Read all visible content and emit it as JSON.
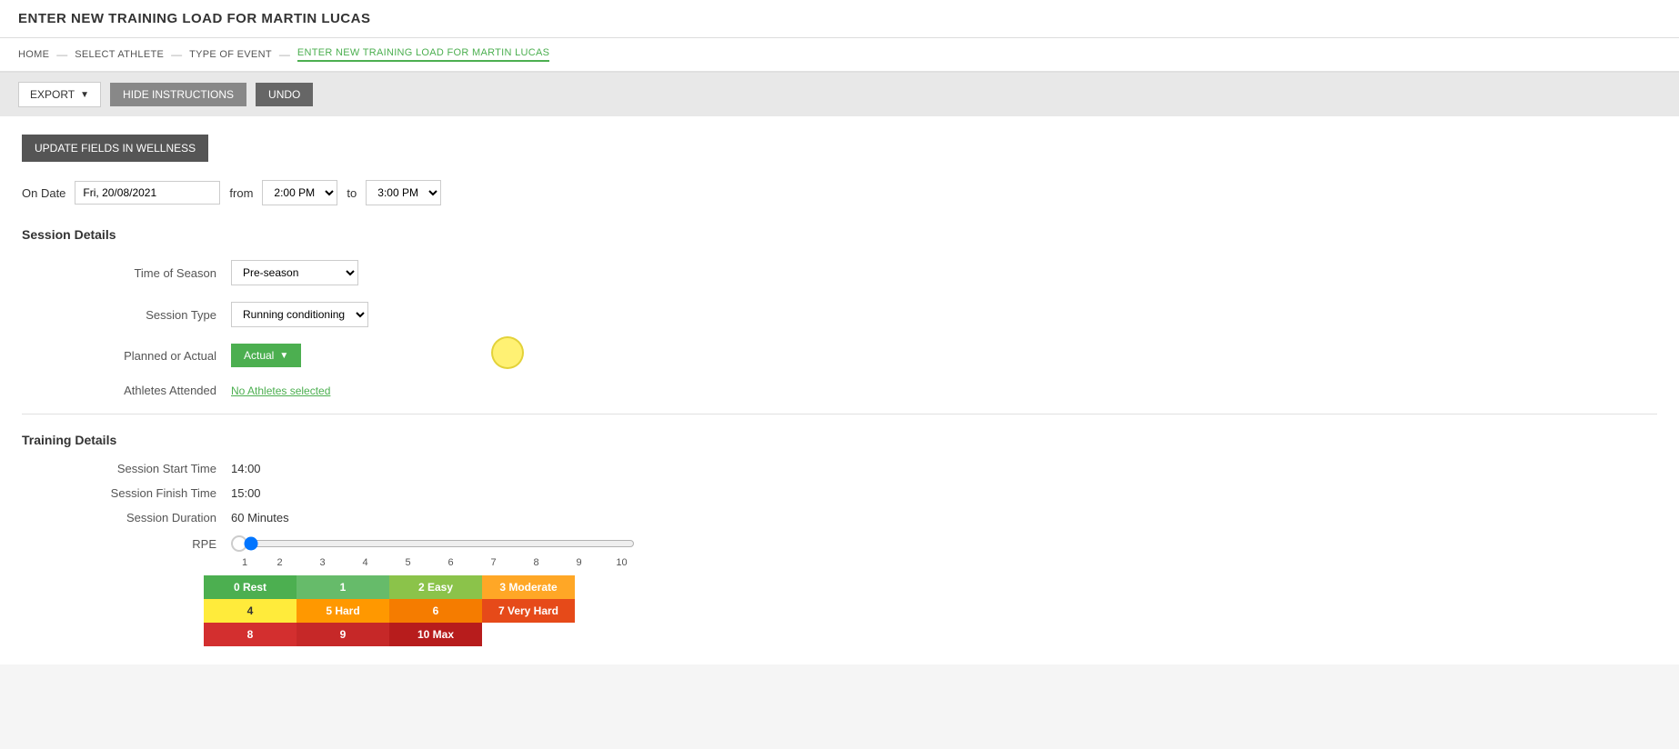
{
  "pageTitle": "ENTER NEW TRAINING LOAD FOR MARTIN LUCAS",
  "breadcrumb": {
    "items": [
      {
        "label": "HOME",
        "active": false
      },
      {
        "label": "SELECT ATHLETE",
        "active": false
      },
      {
        "label": "TYPE OF EVENT",
        "active": false
      },
      {
        "label": "ENTER NEW TRAINING LOAD FOR MARTIN LUCAS",
        "active": true
      }
    ],
    "separators": [
      "—",
      "—",
      "—"
    ]
  },
  "toolbar": {
    "exportLabel": "EXPORT",
    "hideInstructionsLabel": "HIDE INSTRUCTIONS",
    "undoLabel": "UNDO"
  },
  "updateWellnessLabel": "UPDATE FIELDS IN WELLNESS",
  "dateRow": {
    "onDateLabel": "On Date",
    "dateValue": "Fri, 20/08/2021",
    "fromLabel": "from",
    "fromTime": "2:00 PM",
    "toLabel": "to",
    "toTime": "3:00 PM"
  },
  "sessionDetails": {
    "title": "Session Details",
    "timeOfSeasonLabel": "Time of Season",
    "timeOfSeasonValue": "Pre-season",
    "sessionTypeLabel": "Session Type",
    "sessionTypeValue": "Running conditioning",
    "plannedOrActualLabel": "Planned or Actual",
    "plannedOrActualValue": "Actual",
    "athletesAttendedLabel": "Athletes Attended",
    "athletesAttendedValue": "No Athletes selected"
  },
  "trainingDetails": {
    "title": "Training Details",
    "sessionStartTimeLabel": "Session Start Time",
    "sessionStartTimeValue": "14:00",
    "sessionFinishTimeLabel": "Session Finish Time",
    "sessionFinishTimeValue": "15:00",
    "sessionDurationLabel": "Session Duration",
    "sessionDurationValue": "60 Minutes",
    "rpeLabel": "RPE",
    "rpeTicks": [
      "1",
      "2",
      "3",
      "4",
      "5",
      "6",
      "7",
      "8",
      "9",
      "10"
    ]
  },
  "rpeLegend": {
    "row1": [
      {
        "label": "0 Rest",
        "color": "green-0"
      },
      {
        "label": "1",
        "color": "green-1"
      },
      {
        "label": "2 Easy",
        "color": "green-2"
      },
      {
        "label": "3 Moderate",
        "color": "orange-3"
      }
    ],
    "row2": [
      {
        "label": "4",
        "color": "yellow-4"
      },
      {
        "label": "5 Hard",
        "color": "orange-5"
      },
      {
        "label": "6",
        "color": "darkorange-6"
      },
      {
        "label": "7 Very Hard",
        "color": "red-7"
      }
    ],
    "row3": [
      {
        "label": "8",
        "color": "darkred-8"
      },
      {
        "label": "9",
        "color": "darkred-9"
      },
      {
        "label": "10 Max",
        "color": "darkred-10"
      }
    ]
  }
}
